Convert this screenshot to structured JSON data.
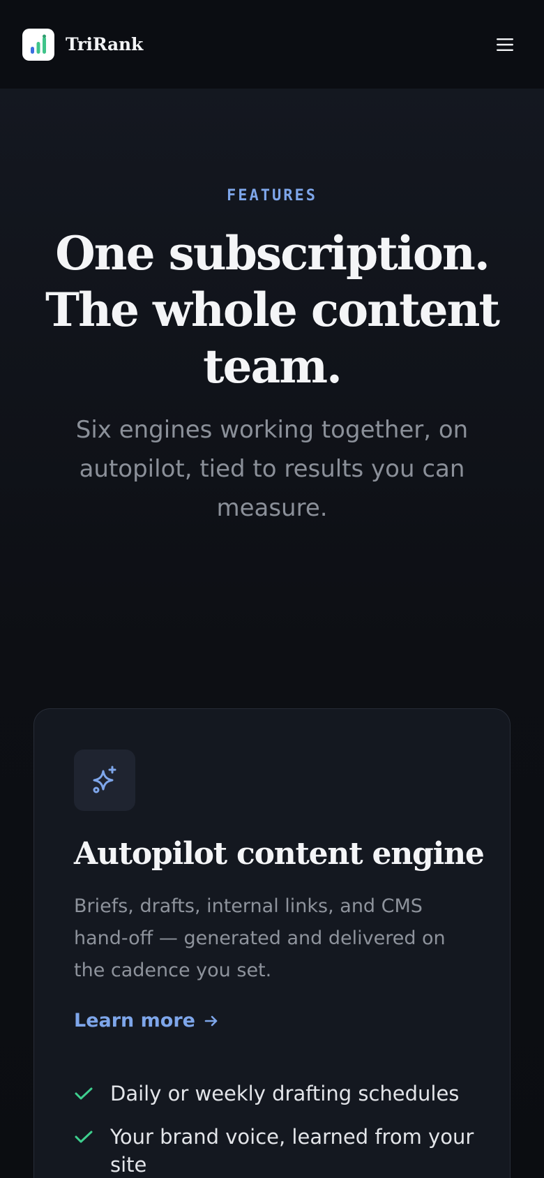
{
  "header": {
    "brand_name": "TriRank",
    "logo_icon": "bar-chart-icon",
    "menu_icon": "hamburger-menu-icon"
  },
  "hero": {
    "eyebrow": "FEATURES",
    "headline": "One subscription. The whole content team.",
    "subhead": "Six engines working together, on autopilot, tied to results you can measure."
  },
  "card": {
    "icon": "sparkles-icon",
    "title": "Autopilot content engine",
    "description": "Briefs, drafts, internal links, and CMS hand-off — generated and delivered on the cadence you set.",
    "link_label": "Learn more",
    "link_icon": "arrow-right-icon",
    "features": [
      "Daily or weekly drafting schedules",
      "Your brand voice, learned from your site"
    ]
  },
  "colors": {
    "accent": "#7ea6ea",
    "check": "#3ecf8e",
    "background": "#0d0f14",
    "card": "#141820"
  }
}
